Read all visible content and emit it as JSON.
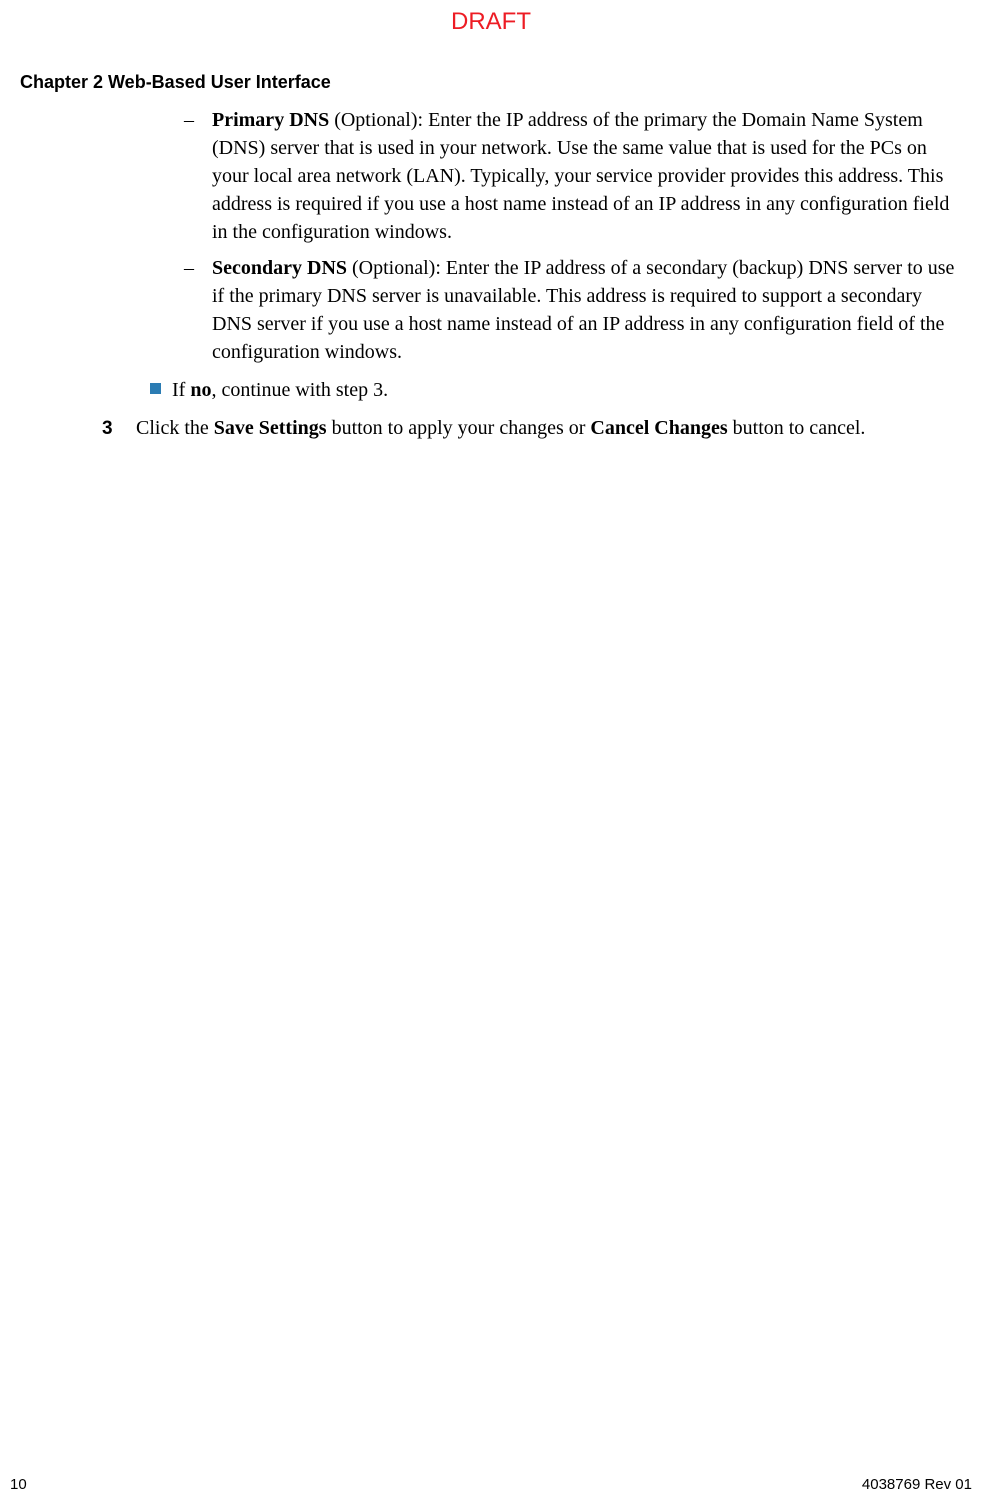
{
  "watermark": "DRAFT",
  "header": "Chapter 2    Web-Based User Interface",
  "items": {
    "primaryDns": {
      "bold": "Primary DNS",
      "rest": " (Optional): Enter the IP address of the primary the Domain Name System (DNS) server that is used in your network. Use the same value that is used for the PCs on your local area network (LAN). Typically, your service provider provides this address. This address is required if you use a host name instead of an IP address in any configuration field in the configuration windows."
    },
    "secondaryDns": {
      "bold": "Secondary DNS",
      "rest": " (Optional): Enter the IP address of a secondary (backup) DNS server to use if the primary DNS server is unavailable. This address is required to support a secondary DNS server if you use a host name instead of an IP address in any configuration field of the configuration windows."
    },
    "ifNo": {
      "pre": "If ",
      "bold": "no",
      "post": ", continue with step 3."
    },
    "step3": {
      "num": "3",
      "t1": "Click the ",
      "b1": "Save Settings",
      "t2": " button to apply your changes or ",
      "b2": "Cancel Changes",
      "t3": " button to cancel."
    }
  },
  "footer": {
    "pageNum": "10",
    "docRef": "4038769 Rev 01"
  }
}
